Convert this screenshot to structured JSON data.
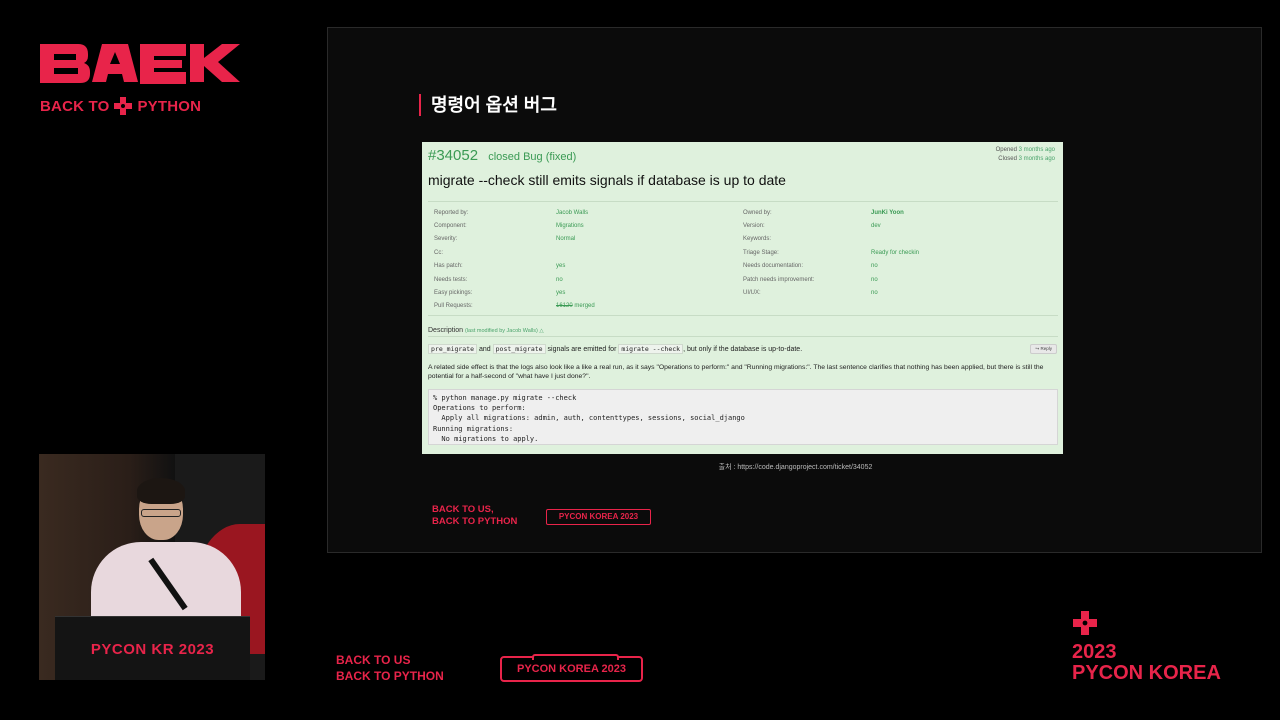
{
  "branding": {
    "logo_text": "BAEK",
    "tagline_left": "BACK TO",
    "tagline_right": "PYTHON",
    "accent_color": "#e8244a"
  },
  "speaker_cam": {
    "podium_text": "PYCON KR 2023"
  },
  "slide": {
    "title": "명령어 옵션 버그",
    "caption": "출처 : https://code.djangoproject.com/ticket/34052",
    "footer_tag_line1": "BACK TO US,",
    "footer_tag_line2": "BACK TO PYTHON",
    "footer_badge": "PYCON KOREA 2023",
    "ticket": {
      "number": "#34052",
      "status_prefix": "closed Bug (",
      "status_resolution": "fixed",
      "status_suffix": ")",
      "opened_label": "Opened",
      "opened_value": "3 months ago",
      "closed_label": "Closed",
      "closed_value": "3 months ago",
      "summary": "migrate --check still emits signals if database is up to date",
      "properties": [
        {
          "k1": "Reported by:",
          "v1": "Jacob Walls",
          "k2": "Owned by:",
          "v2": "JunKi Yoon"
        },
        {
          "k1": "Component:",
          "v1": "Migrations",
          "k2": "Version:",
          "v2": "dev"
        },
        {
          "k1": "Severity:",
          "v1": "Normal",
          "k2": "Keywords:",
          "v2": ""
        },
        {
          "k1": "Cc:",
          "v1": "",
          "k2": "Triage Stage:",
          "v2": "Ready for checkin"
        },
        {
          "k1": "Has patch:",
          "v1": "yes",
          "k2": "Needs documentation:",
          "v2": "no"
        },
        {
          "k1": "Needs tests:",
          "v1": "no",
          "k2": "Patch needs improvement:",
          "v2": "no"
        },
        {
          "k1": "Easy pickings:",
          "v1": "yes",
          "k2": "UI/UX:",
          "v2": "no"
        },
        {
          "k1": "Pull Requests:",
          "v1_strike": "16120",
          "v1": " merged",
          "k2": "",
          "v2": ""
        }
      ],
      "description_label": "Description",
      "description_modified": "(last modified by Jacob Walls) △",
      "reply_label": "↪ Reply",
      "p1_code1": "pre_migrate",
      "p1_and": " and ",
      "p1_code2": "post_migrate",
      "p1_mid": " signals are emitted for ",
      "p1_code3": "migrate --check",
      "p1_end": ", but only if the database is up-to-date.",
      "p2": "A related side effect is that the logs also look like a like a real run, as it says \"Operations to perform:\" and \"Running migrations:\". The last sentence clarifies that nothing has been applied, but there is still the potential for a half-second of \"what have I just done?\".",
      "code_block": "% python manage.py migrate --check\nOperations to perform:\n  Apply all migrations: admin, auth, contenttypes, sessions, social_django\nRunning migrations:\n  No migrations to apply."
    }
  },
  "overlay": {
    "bottom_tag_line1": "BACK TO US",
    "bottom_tag_line2": "BACK TO PYTHON",
    "bottom_badge": "PYCON KOREA 2023",
    "right_year": "2023",
    "right_name": "PYCON KOREA"
  }
}
